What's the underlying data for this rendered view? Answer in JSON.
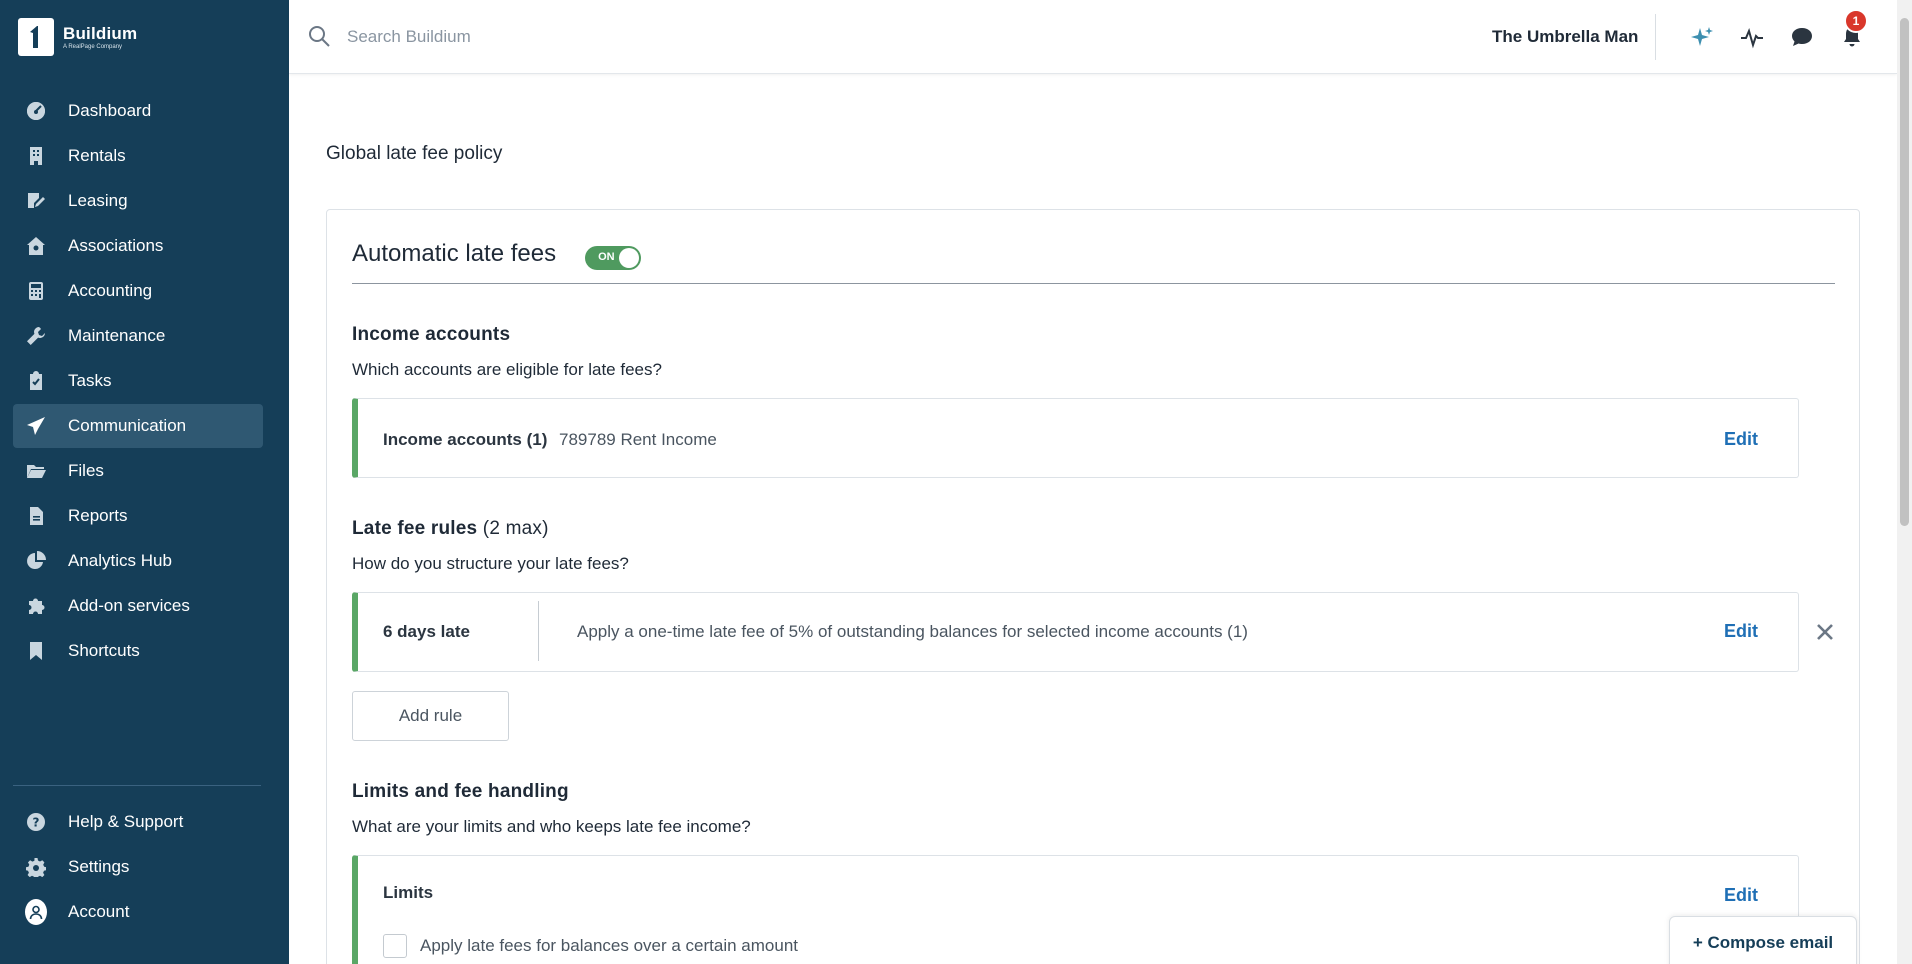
{
  "app": {
    "brand_name": "Buildium",
    "brand_tagline": "A RealPage Company"
  },
  "sidebar": {
    "items": [
      {
        "label": "Dashboard",
        "icon": "dashboard-icon"
      },
      {
        "label": "Rentals",
        "icon": "building-icon"
      },
      {
        "label": "Leasing",
        "icon": "lease-icon"
      },
      {
        "label": "Associations",
        "icon": "association-icon"
      },
      {
        "label": "Accounting",
        "icon": "calculator-icon"
      },
      {
        "label": "Maintenance",
        "icon": "wrench-icon"
      },
      {
        "label": "Tasks",
        "icon": "clipboard-icon"
      },
      {
        "label": "Communication",
        "icon": "paper-plane-icon"
      },
      {
        "label": "Files",
        "icon": "folder-icon"
      },
      {
        "label": "Reports",
        "icon": "report-icon"
      },
      {
        "label": "Analytics Hub",
        "icon": "pie-chart-icon"
      },
      {
        "label": "Add-on services",
        "icon": "puzzle-icon"
      },
      {
        "label": "Shortcuts",
        "icon": "bookmark-icon"
      }
    ],
    "active": "Communication",
    "bottom_items": [
      {
        "label": "Help & Support",
        "icon": "help-icon"
      },
      {
        "label": "Settings",
        "icon": "gear-icon"
      },
      {
        "label": "Account",
        "icon": "account-icon"
      }
    ]
  },
  "topbar": {
    "search_placeholder": "Search Buildium",
    "org_name": "The Umbrella Man",
    "notification_count": "1"
  },
  "page": {
    "title": "Global late fee policy",
    "card_title": "Automatic late fees",
    "toggle_label": "ON",
    "income": {
      "title": "Income accounts",
      "desc": "Which accounts are eligible for late fees?",
      "box_label": "Income accounts (1)",
      "box_value": "789789 Rent Income",
      "edit": "Edit"
    },
    "rules": {
      "title": "Late fee rules",
      "title_suffix": "(2 max)",
      "desc": "How do you structure your late fees?",
      "rule_label": "6 days late",
      "rule_value": "Apply a one-time late fee of 5% of outstanding balances for selected income accounts (1)",
      "edit": "Edit",
      "add_rule": "Add rule"
    },
    "limits": {
      "title": "Limits and fee handling",
      "desc": "What are your limits and who keeps late fee income?",
      "box_label": "Limits",
      "edit": "Edit",
      "checkbox_label": "Apply late fees for balances over a certain amount"
    },
    "compose_email": "+ Compose email"
  },
  "colors": {
    "sidebar_bg": "#153e58",
    "active_item_bg": "#2f5872",
    "accent_green": "#5aa766",
    "link_blue": "#1f6fb5",
    "badge_red": "#d9372b"
  }
}
